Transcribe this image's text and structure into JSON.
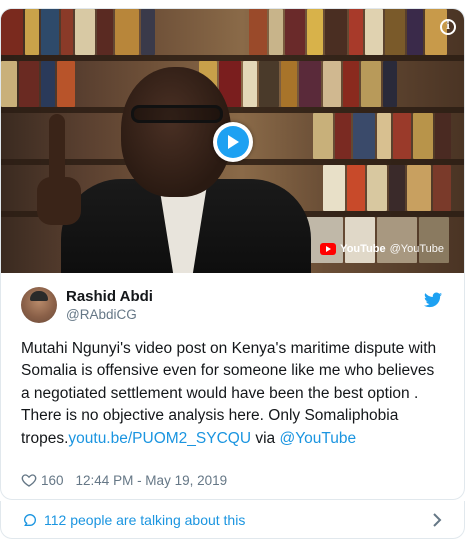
{
  "video": {
    "info_icon": "info-icon",
    "play_icon": "play-icon",
    "source_brand": "YouTube",
    "source_handle": "@YouTube",
    "accent_color": "#1da1f2"
  },
  "author": {
    "display_name": "Rashid Abdi",
    "handle": "@RAbdiCG",
    "avatar_icon": "avatar"
  },
  "tweet": {
    "text": "Mutahi Ngunyi's video post on Kenya's maritime dispute with Somalia is offensive even for someone like me who believes a negotiated settlement would have been the best option . There is no objective analysis here. Only Somaliphobia tropes.",
    "link_text": "youtu.be/PUOM2_SYCQU",
    "via_text": " via ",
    "mention": "@YouTube",
    "link_color": "#1b95e0"
  },
  "meta": {
    "likes": "160",
    "timestamp": "12:44 PM - May 19, 2019"
  },
  "footer": {
    "talking_label": "112 people are talking about this"
  }
}
